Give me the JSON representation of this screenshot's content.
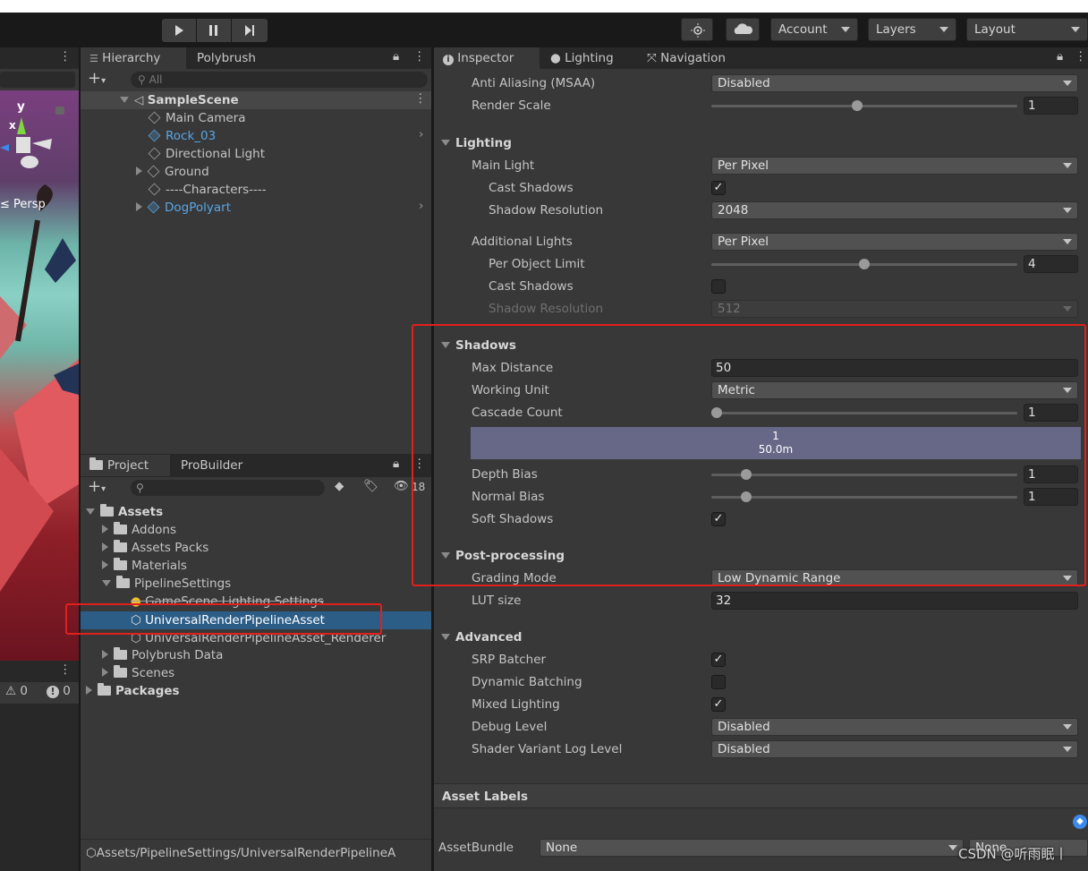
{
  "toolbar": {
    "account": "Account",
    "layers": "Layers",
    "layout": "Layout"
  },
  "scene": {
    "axis_y": "y",
    "axis_x": "x",
    "persp": "Persp",
    "warn_count": "0",
    "error_count": "0"
  },
  "hierarchy": {
    "tabs": [
      "Hierarchy",
      "Polybrush"
    ],
    "search_placeholder": "All",
    "scene_name": "SampleScene",
    "items": [
      "Main Camera",
      "Rock_03",
      "Directional Light",
      "Ground",
      "----Characters----",
      "DogPolyart"
    ]
  },
  "project": {
    "tabs": [
      "Project",
      "ProBuilder"
    ],
    "hidden_count": "18",
    "items": [
      "Assets",
      "Addons",
      "Assets Packs",
      "Materials",
      "PipelineSettings",
      "GameScene Lighting Settings",
      "UniversalRenderPipelineAsset",
      "UniversalRenderPipelineAsset_Renderer",
      "Polybrush Data",
      "Scenes",
      "Packages"
    ],
    "path": "Assets/PipelineSettings/UniversalRenderPipelineA"
  },
  "inspector": {
    "tabs": [
      "Inspector",
      "Lighting",
      "Navigation"
    ],
    "anti_aliasing": {
      "label": "Anti Aliasing (MSAA)",
      "value": "Disabled"
    },
    "render_scale": {
      "label": "Render Scale",
      "value": "1"
    },
    "lighting": {
      "header": "Lighting",
      "main_light": {
        "label": "Main Light",
        "value": "Per Pixel"
      },
      "cast_shadows": {
        "label": "Cast Shadows"
      },
      "shadow_resolution": {
        "label": "Shadow Resolution",
        "value": "2048"
      },
      "additional_lights": {
        "label": "Additional Lights",
        "value": "Per Pixel"
      },
      "per_object_limit": {
        "label": "Per Object Limit",
        "value": "4"
      },
      "add_cast_shadows": {
        "label": "Cast Shadows"
      },
      "add_shadow_resolution": {
        "label": "Shadow Resolution",
        "value": "512"
      }
    },
    "shadows": {
      "header": "Shadows",
      "max_distance": {
        "label": "Max Distance",
        "value": "50"
      },
      "working_unit": {
        "label": "Working Unit",
        "value": "Metric"
      },
      "cascade_count": {
        "label": "Cascade Count",
        "value": "1"
      },
      "cascade_bar": {
        "index": "1",
        "distance": "50.0m"
      },
      "depth_bias": {
        "label": "Depth Bias",
        "value": "1"
      },
      "normal_bias": {
        "label": "Normal Bias",
        "value": "1"
      },
      "soft_shadows": {
        "label": "Soft Shadows"
      }
    },
    "post": {
      "header": "Post-processing",
      "grading_mode": {
        "label": "Grading Mode",
        "value": "Low Dynamic Range"
      },
      "lut_size": {
        "label": "LUT size",
        "value": "32"
      }
    },
    "advanced": {
      "header": "Advanced",
      "srp_batcher": {
        "label": "SRP Batcher"
      },
      "dynamic_batching": {
        "label": "Dynamic Batching"
      },
      "mixed_lighting": {
        "label": "Mixed Lighting"
      },
      "debug_level": {
        "label": "Debug Level",
        "value": "Disabled"
      },
      "shader_log": {
        "label": "Shader Variant Log Level",
        "value": "Disabled"
      }
    },
    "asset_labels": "Asset Labels",
    "asset_bundle": {
      "label": "AssetBundle",
      "value": "None",
      "variant": "None"
    }
  },
  "watermark": "CSDN @听雨眠丨",
  "colors": {
    "highlight": "#e0201c",
    "selection": "#2c5d87",
    "link_blue": "#56a6e8"
  }
}
